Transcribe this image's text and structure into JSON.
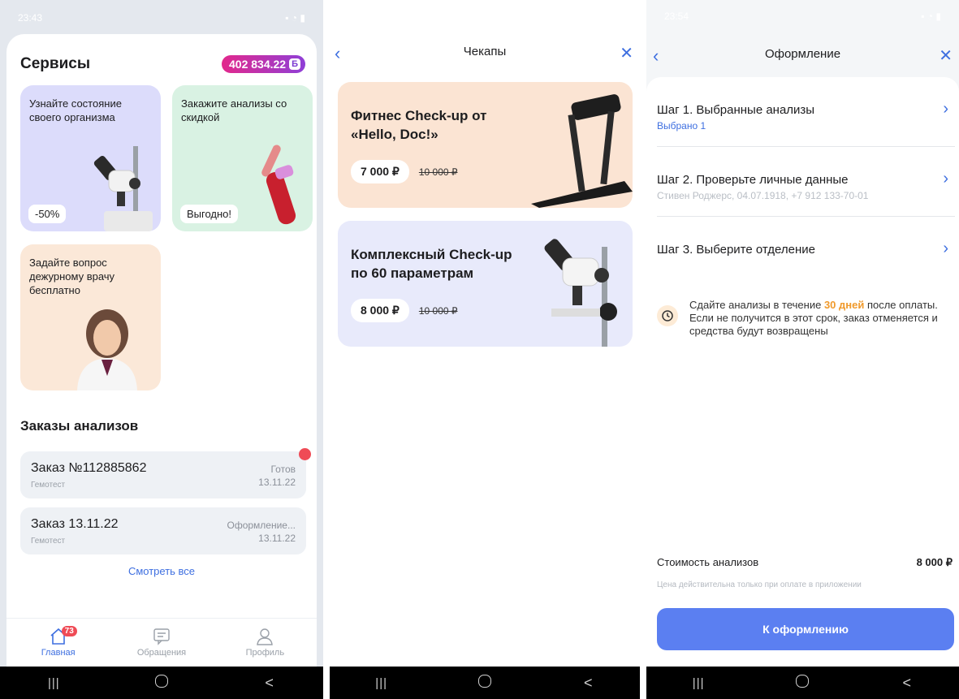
{
  "screen1": {
    "status_time": "23:43",
    "title": "Сервисы",
    "balance": "402 834.22",
    "balance_currency": "Б",
    "cards": [
      {
        "text": "Узнайте состояние своего организма",
        "chip": "-50%",
        "color": "#dcdcfb"
      },
      {
        "text": "Закажите анализы со скидкой",
        "chip": "Выгодно!",
        "color": "#d9f2e3"
      },
      {
        "text": "Задайте вопрос дежурному врачу бесплатно",
        "color": "#fbe8d8"
      }
    ],
    "orders_title": "Заказы анализов",
    "orders": [
      {
        "number": "Заказ №112885862",
        "lab": "Гемотест",
        "status": "Готов",
        "date": "13.11.22"
      },
      {
        "number": "Заказ 13.11.22",
        "lab": "Гемотест",
        "status": "Оформление...",
        "date": "13.11.22"
      }
    ],
    "see_all": "Смотреть все",
    "tabs": [
      {
        "label": "Главная",
        "badge": "73",
        "icon": "home-icon"
      },
      {
        "label": "Обращения",
        "icon": "chat-icon"
      },
      {
        "label": "Профиль",
        "icon": "profile-icon"
      }
    ]
  },
  "screen2": {
    "title": "Чекапы",
    "offers": [
      {
        "title": "Фитнес Check-up от «Hello, Doc!»",
        "price": "7 000 ₽",
        "old_price": "10 000 ₽",
        "color": "#fbe4d3"
      },
      {
        "title": "Комплексный Check-up по 60 параметрам",
        "price": "8 000 ₽",
        "old_price": "10 000 ₽",
        "color": "#e8eafb"
      }
    ]
  },
  "screen3": {
    "status_time": "23:54",
    "title": "Оформление",
    "steps": [
      {
        "title": "Шаг 1. Выбранные анализы",
        "sub": "Выбрано 1"
      },
      {
        "title": "Шаг 2. Проверьте личные данные",
        "sub": "Стивен Роджерс, 04.07.1918, +7 912 133-70-01"
      },
      {
        "title": "Шаг 3. Выберите отделение",
        "sub": ""
      }
    ],
    "note_before": "Сдайте анализы в течение ",
    "note_highlight": "30 дней",
    "note_after": " после оплаты. Если не получится в этот срок, заказ отменяется и средства будут возвращены",
    "cost_label": "Стоимость анализов",
    "cost_value": "8 000 ₽",
    "hint": "Цена действительна только при оплате в приложении",
    "cta": "К оформлению"
  }
}
